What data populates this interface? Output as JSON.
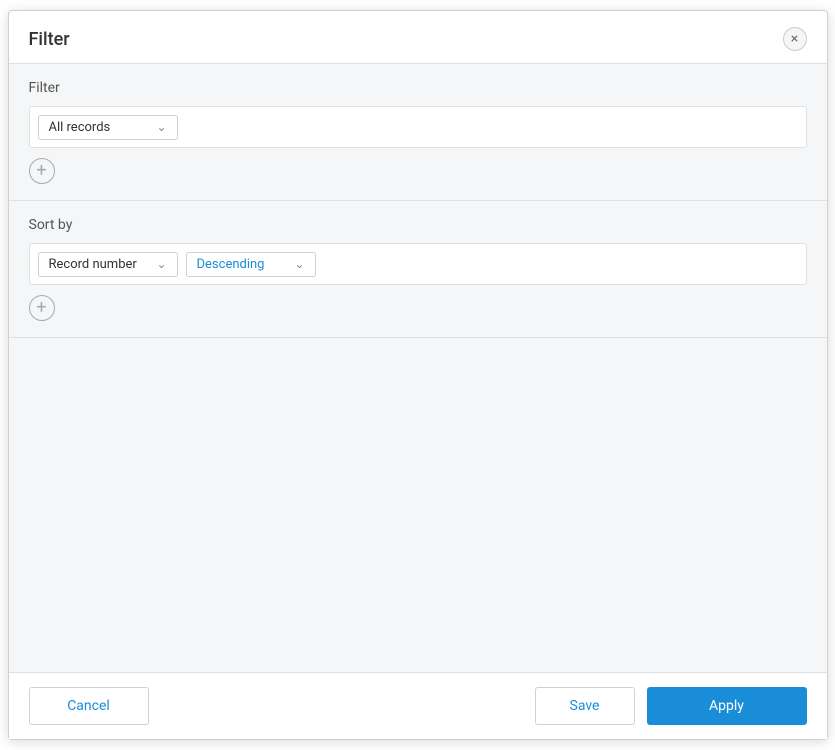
{
  "dialog": {
    "title": "Filter",
    "close_label": "×"
  },
  "filter_section": {
    "label": "Filter",
    "dropdown_value": "All records",
    "add_button_label": "+"
  },
  "sort_section": {
    "label": "Sort by",
    "field_dropdown_value": "Record number",
    "order_dropdown_value": "Descending",
    "add_button_label": "+"
  },
  "footer": {
    "cancel_label": "Cancel",
    "save_label": "Save",
    "apply_label": "Apply"
  }
}
